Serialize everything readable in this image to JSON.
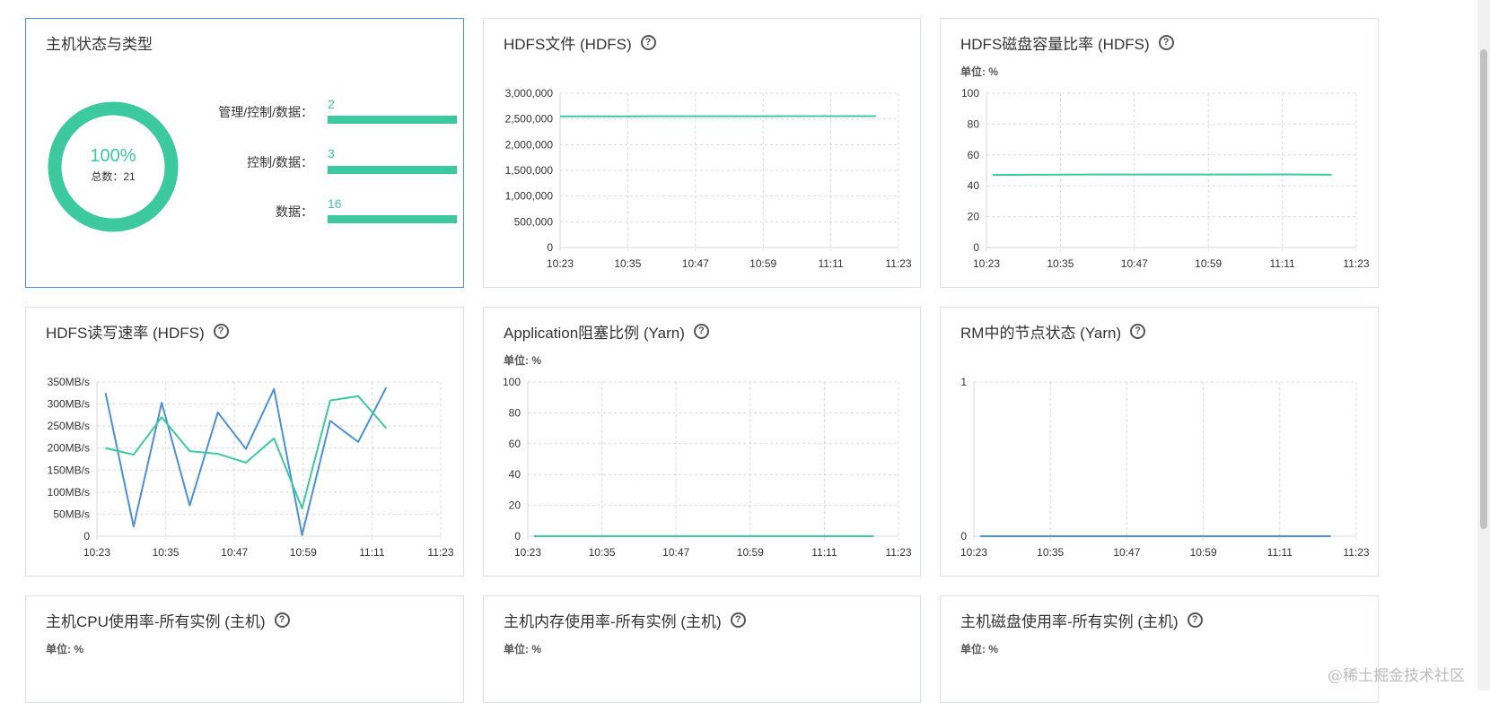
{
  "colors": {
    "green": "#3cc9a0",
    "blue": "#4a90d9",
    "grid": "#d9d9d9"
  },
  "host_panel": {
    "title": "主机状态与类型",
    "percent": "100%",
    "total_label": "总数：",
    "total_value": "21",
    "rows": [
      {
        "label": "管理/控制/数据：",
        "value": "2"
      },
      {
        "label": "控制/数据：",
        "value": "3"
      },
      {
        "label": "数据：",
        "value": "16"
      }
    ]
  },
  "panels": {
    "hdfs_files": {
      "title": "HDFS文件 (HDFS)"
    },
    "hdfs_disk": {
      "title": "HDFS磁盘容量比率 (HDFS)",
      "unit": "单位: %"
    },
    "hdfs_rw": {
      "title": "HDFS读写速率 (HDFS)"
    },
    "app_block": {
      "title": "Application阻塞比例 (Yarn)",
      "unit": "单位: %"
    },
    "rm_nodes": {
      "title": "RM中的节点状态 (Yarn)"
    },
    "host_cpu": {
      "title": "主机CPU使用率-所有实例 (主机)",
      "unit": "单位: %"
    },
    "host_mem": {
      "title": "主机内存使用率-所有实例 (主机)",
      "unit": "单位: %"
    },
    "host_disk": {
      "title": "主机磁盘使用率-所有实例 (主机)",
      "unit": "单位: %"
    }
  },
  "help_glyph": "?",
  "watermark": "@稀土掘金技术社区",
  "chart_data": [
    {
      "id": "hdfs_files",
      "type": "line",
      "x_ticks": [
        "10:23",
        "10:35",
        "10:47",
        "10:59",
        "11:11",
        "11:23"
      ],
      "y_ticks": [
        "0",
        "500,000",
        "1,000,000",
        "1,500,000",
        "2,000,000",
        "2,500,000",
        "3,000,000"
      ],
      "ylim": [
        0,
        3000000
      ],
      "xlim": [
        0,
        60
      ],
      "grid": true,
      "series": [
        {
          "color": "#3cc9a0",
          "x": [
            0,
            4,
            8,
            12,
            16,
            20,
            24,
            28,
            32,
            36,
            40,
            44,
            48,
            52,
            56
          ],
          "values": [
            2550000,
            2550000,
            2551000,
            2551000,
            2552000,
            2552000,
            2553000,
            2553000,
            2554000,
            2554000,
            2555000,
            2555000,
            2556000,
            2556000,
            2556000
          ]
        }
      ]
    },
    {
      "id": "hdfs_disk",
      "type": "line",
      "x_ticks": [
        "10:23",
        "10:35",
        "10:47",
        "10:59",
        "11:11",
        "11:23"
      ],
      "y_ticks": [
        "0",
        "20",
        "40",
        "60",
        "80",
        "100"
      ],
      "ylim": [
        0,
        100
      ],
      "xlim": [
        0,
        60
      ],
      "grid": true,
      "series": [
        {
          "color": "#3cc9a0",
          "x": [
            1,
            8,
            16,
            24,
            32,
            40,
            48,
            56
          ],
          "values": [
            47,
            47.2,
            47.3,
            47.3,
            47.3,
            47.3,
            47.4,
            47.2
          ]
        }
      ]
    },
    {
      "id": "hdfs_rw",
      "type": "line",
      "x_ticks": [
        "10:23",
        "10:35",
        "10:47",
        "10:59",
        "11:11",
        "11:23"
      ],
      "y_ticks": [
        "0",
        "50MB/s",
        "100MB/s",
        "150MB/s",
        "200MB/s",
        "250MB/s",
        "300MB/s",
        "350MB/s"
      ],
      "ylim": [
        0,
        350
      ],
      "xlim": [
        0,
        60
      ],
      "grid": true,
      "series": [
        {
          "color": "#4a90d9",
          "x": [
            1.5,
            6.4,
            11.3,
            16.2,
            21.1,
            26,
            30.9,
            35.8,
            40.7,
            45.6,
            50.5
          ],
          "values": [
            325,
            22,
            303,
            70,
            281,
            198,
            334,
            3,
            262,
            214,
            338
          ]
        },
        {
          "color": "#3cc9a0",
          "x": [
            1.5,
            6.4,
            11.3,
            16.2,
            21.1,
            26,
            30.9,
            35.8,
            40.7,
            45.6,
            50.5
          ],
          "values": [
            200,
            185,
            270,
            193,
            187,
            167,
            222,
            63,
            308,
            318,
            245
          ]
        }
      ]
    },
    {
      "id": "app_block",
      "type": "line",
      "x_ticks": [
        "10:23",
        "10:35",
        "10:47",
        "10:59",
        "11:11",
        "11:23"
      ],
      "y_ticks": [
        "0",
        "20",
        "40",
        "60",
        "80",
        "100"
      ],
      "ylim": [
        0,
        100
      ],
      "xlim": [
        0,
        60
      ],
      "grid": true,
      "series": [
        {
          "color": "#3cc9a0",
          "x": [
            1,
            56
          ],
          "values": [
            0,
            0
          ]
        }
      ]
    },
    {
      "id": "rm_nodes",
      "type": "line",
      "x_ticks": [
        "10:23",
        "10:35",
        "10:47",
        "10:59",
        "11:11",
        "11:23"
      ],
      "y_ticks": [
        "0",
        "1"
      ],
      "ylim": [
        0,
        1
      ],
      "xlim": [
        0,
        60
      ],
      "grid": true,
      "series": [
        {
          "color": "#4a90d9",
          "x": [
            1,
            56
          ],
          "values": [
            0,
            0
          ]
        }
      ]
    }
  ]
}
